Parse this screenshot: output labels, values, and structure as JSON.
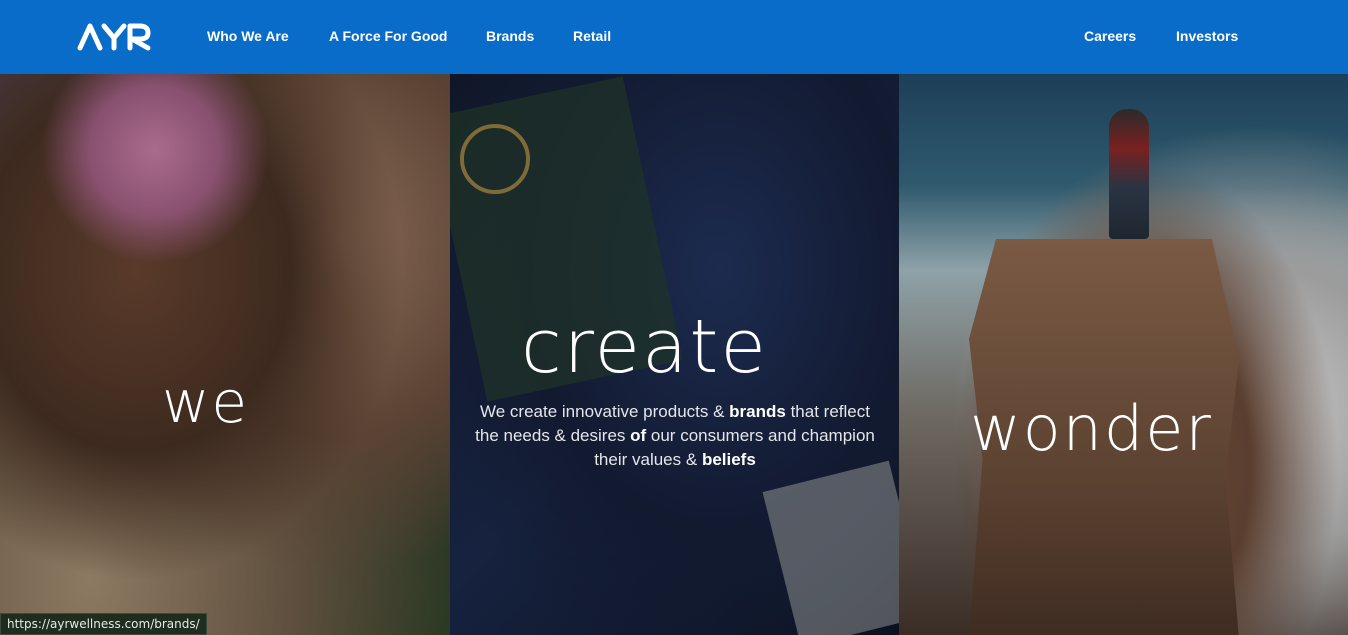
{
  "nav": {
    "logo_text": "AYR",
    "links": [
      "Who We Are",
      "A Force For Good",
      "Brands",
      "Retail"
    ],
    "right_links": [
      "Careers",
      "Investors"
    ]
  },
  "panels": {
    "we": "we",
    "create": "create",
    "wonder": "wonder",
    "tagline": {
      "p1": "We create innovative products & ",
      "b1": "brands",
      "p2": " that reflect the needs & desires ",
      "b2": "of",
      "p3": " our consumers and champion their values & ",
      "b3": "beliefs"
    }
  },
  "status_bar": "https://ayrwellness.com/brands/",
  "colors": {
    "nav": "#0a6cc9",
    "text": "#ffffff"
  }
}
